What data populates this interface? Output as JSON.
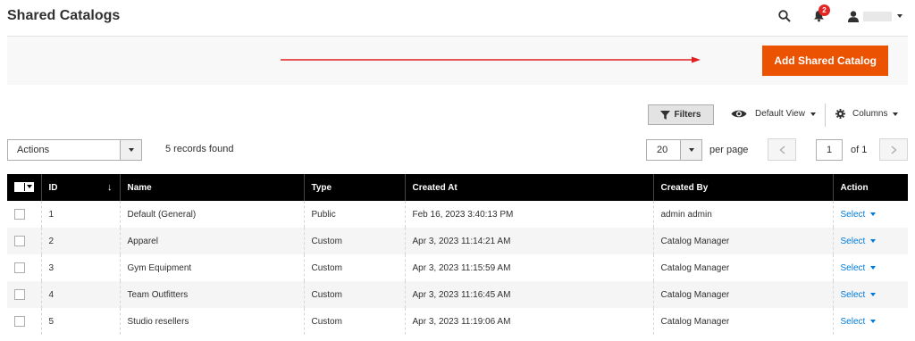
{
  "page": {
    "title": "Shared Catalogs"
  },
  "header": {
    "notification_count": "2",
    "user_name": ""
  },
  "actions_bar": {
    "add_button_label": "Add Shared Catalog"
  },
  "toolbar": {
    "filters_label": "Filters",
    "view_label": "Default View",
    "columns_label": "Columns"
  },
  "mass_actions": {
    "select_label": "Actions",
    "records_found": "5 records found"
  },
  "pagination": {
    "per_page_value": "20",
    "per_page_label": "per page",
    "current_page": "1",
    "of_label": "of 1"
  },
  "table": {
    "columns": [
      "ID",
      "Name",
      "Type",
      "Created At",
      "Created By",
      "Action"
    ],
    "rows": [
      {
        "id": "1",
        "name": "Default (General)",
        "type": "Public",
        "created_at": "Feb 16, 2023 3:40:13 PM",
        "created_by": "admin admin",
        "action": "Select"
      },
      {
        "id": "2",
        "name": "Apparel",
        "type": "Custom",
        "created_at": "Apr 3, 2023 11:14:21 AM",
        "created_by": "Catalog Manager",
        "action": "Select"
      },
      {
        "id": "3",
        "name": "Gym Equipment",
        "type": "Custom",
        "created_at": "Apr 3, 2023 11:15:59 AM",
        "created_by": "Catalog Manager",
        "action": "Select"
      },
      {
        "id": "4",
        "name": "Team Outfitters",
        "type": "Custom",
        "created_at": "Apr 3, 2023 11:16:45 AM",
        "created_by": "Catalog Manager",
        "action": "Select"
      },
      {
        "id": "5",
        "name": "Studio resellers",
        "type": "Custom",
        "created_at": "Apr 3, 2023 11:19:06 AM",
        "created_by": "Catalog Manager",
        "action": "Select"
      }
    ]
  },
  "icons": [
    "search-icon",
    "bell-icon",
    "user-icon",
    "filter-icon",
    "eye-icon",
    "gear-icon",
    "chevron-left-icon",
    "chevron-right-icon",
    "sort-down-icon"
  ],
  "colors": {
    "accent": "#eb5202",
    "link": "#007bdb",
    "header_bg": "#000000",
    "annotation_arrow": "#e02020",
    "badge": "#e22626"
  }
}
